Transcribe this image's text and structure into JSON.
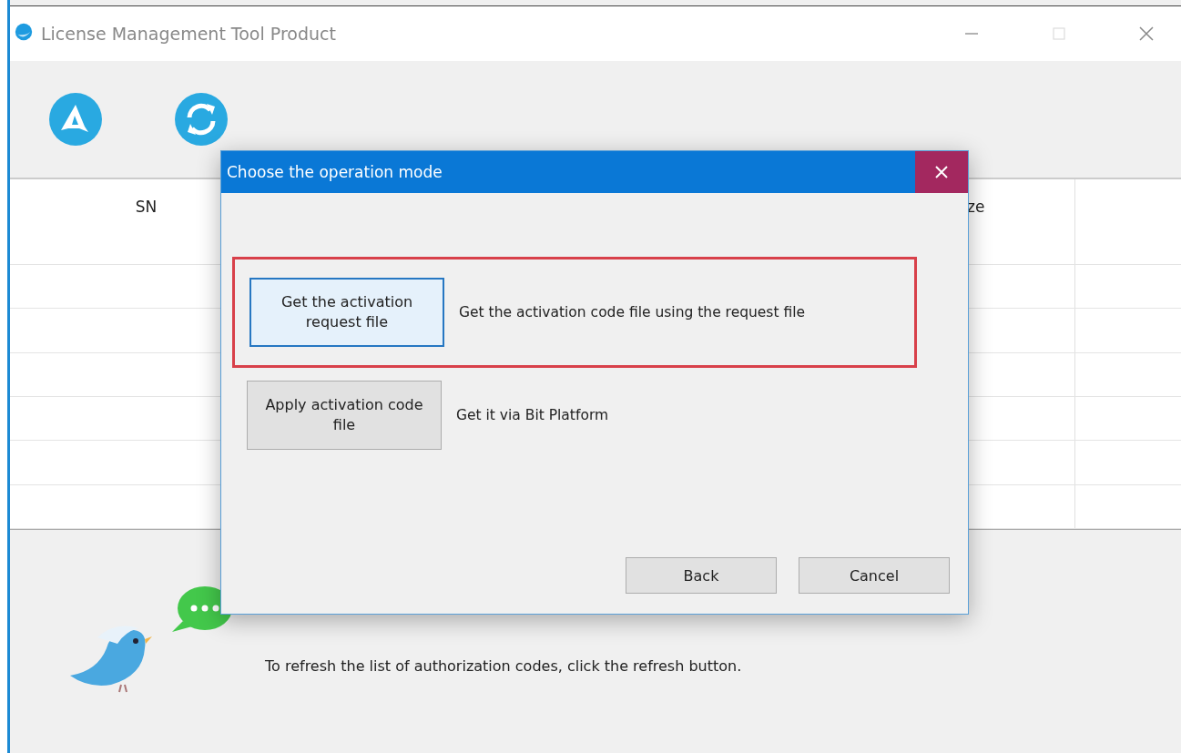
{
  "window": {
    "title": "License Management Tool Product"
  },
  "table": {
    "columns": [
      "SN",
      "ze"
    ]
  },
  "hints": [
    "To refresh the list of authorization codes, click the refresh button."
  ],
  "dialog": {
    "title": "Choose the operation mode",
    "options": [
      {
        "button": "Get the activation request file",
        "description": "Get the activation code file using the request file",
        "focused": true,
        "highlighted": true
      },
      {
        "button": "Apply activation code file",
        "description": "Get it via Bit Platform",
        "focused": false,
        "highlighted": false
      }
    ],
    "buttons": [
      "Back",
      "Cancel"
    ]
  }
}
